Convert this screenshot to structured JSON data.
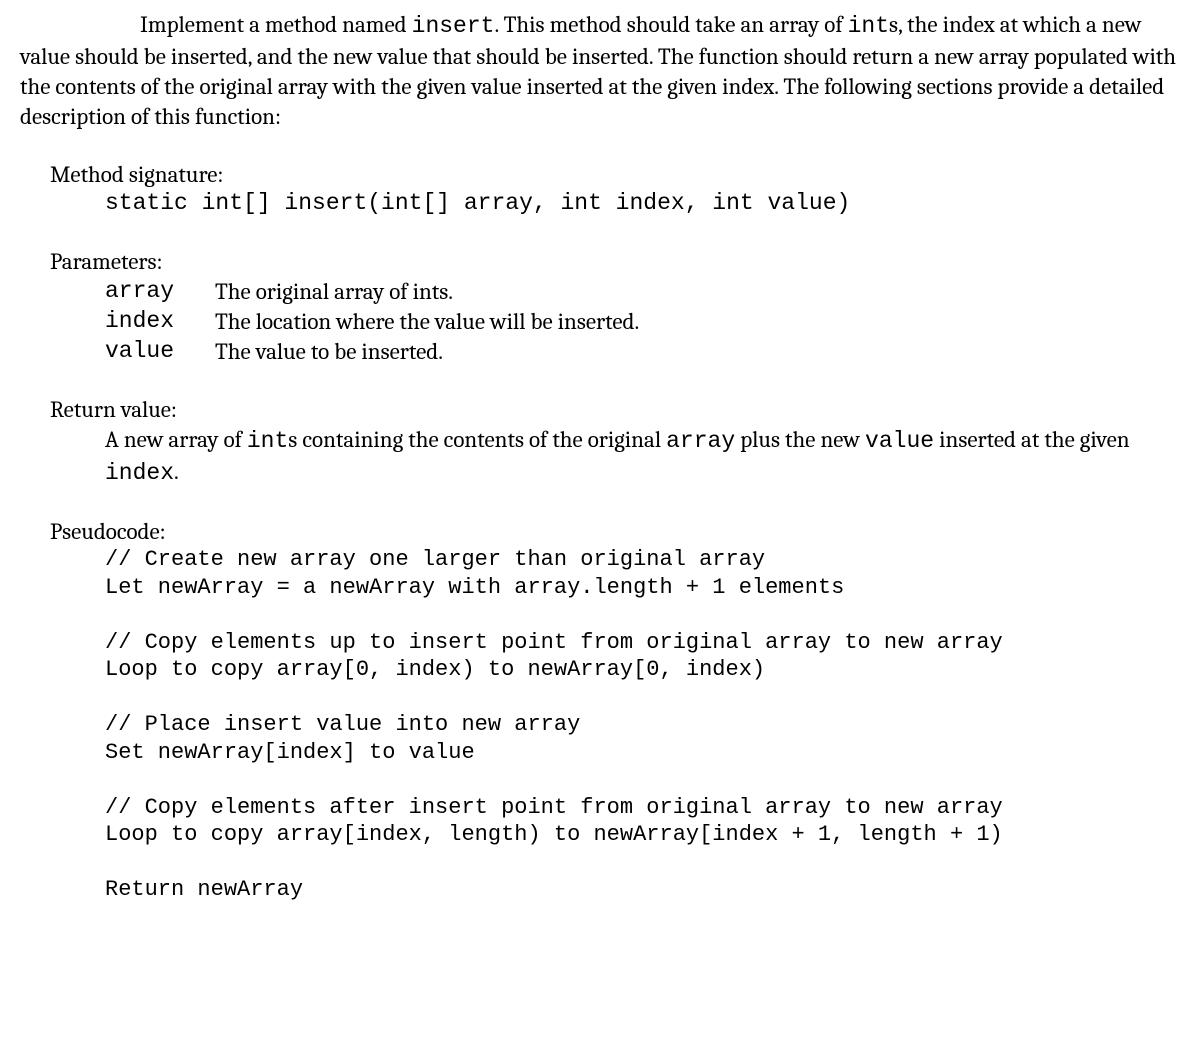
{
  "intro": {
    "part1": "Implement a method named ",
    "code1": "insert",
    "part2": ". This method should take an array of ",
    "code2": "int",
    "part3": "s, the index at which a new value should be inserted, and the new value that should be inserted.  The function should return a new array populated with the contents of the original array with the given value inserted at the given index. The following sections provide a detailed description of this function:"
  },
  "methodSignature": {
    "label": "Method signature:",
    "code": "static int[] insert(int[] array, int index, int value)"
  },
  "parameters": {
    "label": "Parameters:",
    "items": [
      {
        "name": "array",
        "desc": "The original array of ints."
      },
      {
        "name": "index",
        "desc": "The location where the value will be inserted."
      },
      {
        "name": "value",
        "desc": "The value to be inserted."
      }
    ]
  },
  "returnValue": {
    "label": "Return value:",
    "part1": "A new array of ",
    "code1": "int",
    "part2": "s containing the contents of the original ",
    "code2": "array",
    "part3": " plus the new ",
    "code3": "value",
    "part4": " inserted at the given ",
    "code4": "index",
    "part5": "."
  },
  "pseudocode": {
    "label": "Pseudocode:",
    "lines": [
      "// Create new array one larger than original array",
      "Let newArray = a newArray with array.length + 1 elements",
      "",
      "// Copy elements up to insert point from original array to new array",
      "Loop to copy array[0, index) to newArray[0, index)",
      "",
      "// Place insert value into new array",
      "Set newArray[index] to value",
      "",
      "// Copy elements after insert point from original array to new array",
      "Loop to copy array[index, length) to newArray[index + 1, length + 1)",
      "",
      "Return newArray"
    ]
  }
}
